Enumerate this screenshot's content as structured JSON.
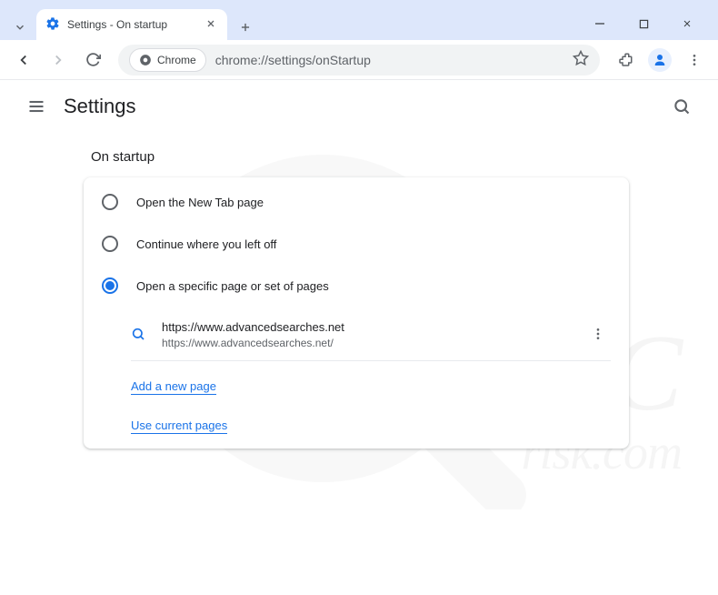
{
  "window": {
    "tab_title": "Settings - On startup"
  },
  "omnibox": {
    "chip": "Chrome",
    "url": "chrome://settings/onStartup"
  },
  "app": {
    "title": "Settings"
  },
  "section": {
    "title": "On startup",
    "options": [
      {
        "label": "Open the New Tab page"
      },
      {
        "label": "Continue where you left off"
      },
      {
        "label": "Open a specific page or set of pages"
      }
    ],
    "page_entry": {
      "name": "https://www.advancedsearches.net",
      "url": "https://www.advancedsearches.net/"
    },
    "add_link": "Add a new page",
    "use_link": "Use current pages"
  },
  "watermark": {
    "line1": "PC",
    "line2": "risk.com"
  }
}
